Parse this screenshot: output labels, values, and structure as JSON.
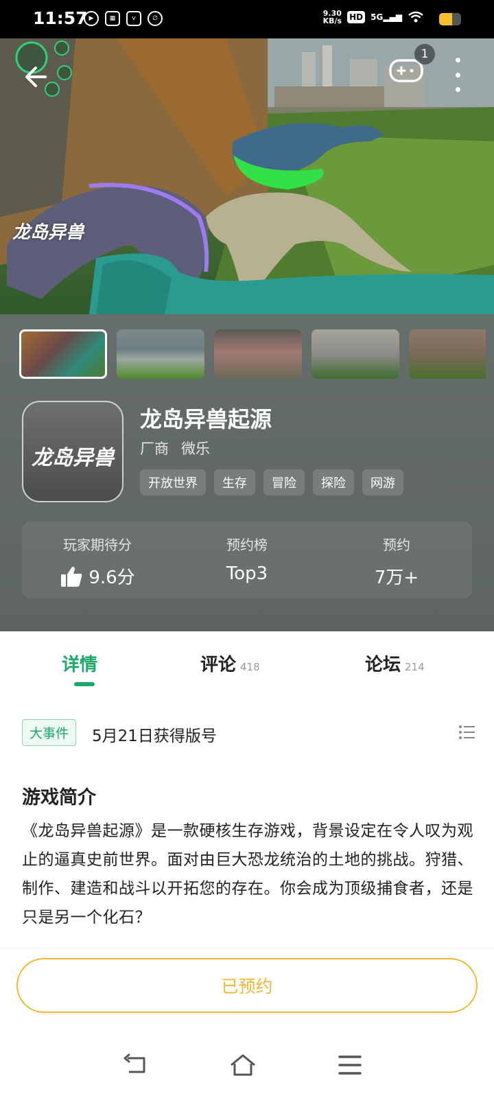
{
  "status_bar": {
    "time": "11:57",
    "net_speed_value": "9.30",
    "net_speed_unit": "KB/s",
    "hd": "HD",
    "network": "5G",
    "battery_level": 0.6,
    "app_icons": [
      "play-icon",
      "subway-icon",
      "vivo-icon",
      "link-icon"
    ]
  },
  "hero": {
    "logo_text": "龙岛异兽",
    "gamepad_badge": "1"
  },
  "thumbnails": [
    "screenshot-1",
    "screenshot-2",
    "screenshot-3",
    "screenshot-4",
    "screenshot-5"
  ],
  "app": {
    "icon_text": "龙岛异兽",
    "title": "龙岛异兽起源",
    "vendor_label": "厂商",
    "vendor_name": "微乐",
    "tags": [
      "开放世界",
      "生存",
      "冒险",
      "探险",
      "网游"
    ]
  },
  "stats": {
    "expect_label": "玩家期待分",
    "expect_value": "9.6分",
    "rank_label": "预约榜",
    "rank_value": "Top3",
    "reserve_label": "预约",
    "reserve_value": "7万+"
  },
  "tabs": [
    {
      "label": "详情",
      "count": ""
    },
    {
      "label": "评论",
      "count": "418"
    },
    {
      "label": "论坛",
      "count": "214"
    }
  ],
  "event": {
    "badge": "大事件",
    "text": "5月21日获得版号"
  },
  "intro": {
    "title": "游戏简介",
    "text": "《龙岛异兽起源》是一款硬核生存游戏，背景设定在令人叹为观止的逼真史前世界。面对由巨大恐龙统治的土地的挑战。狩猎、制作、建造和战斗以开拓您的存在。你会成为顶级捕食者，还是只是另一个化石？"
  },
  "reserve_button": "已预约",
  "colors": {
    "accent": "#1aa86b",
    "reserve": "#f2b830"
  }
}
